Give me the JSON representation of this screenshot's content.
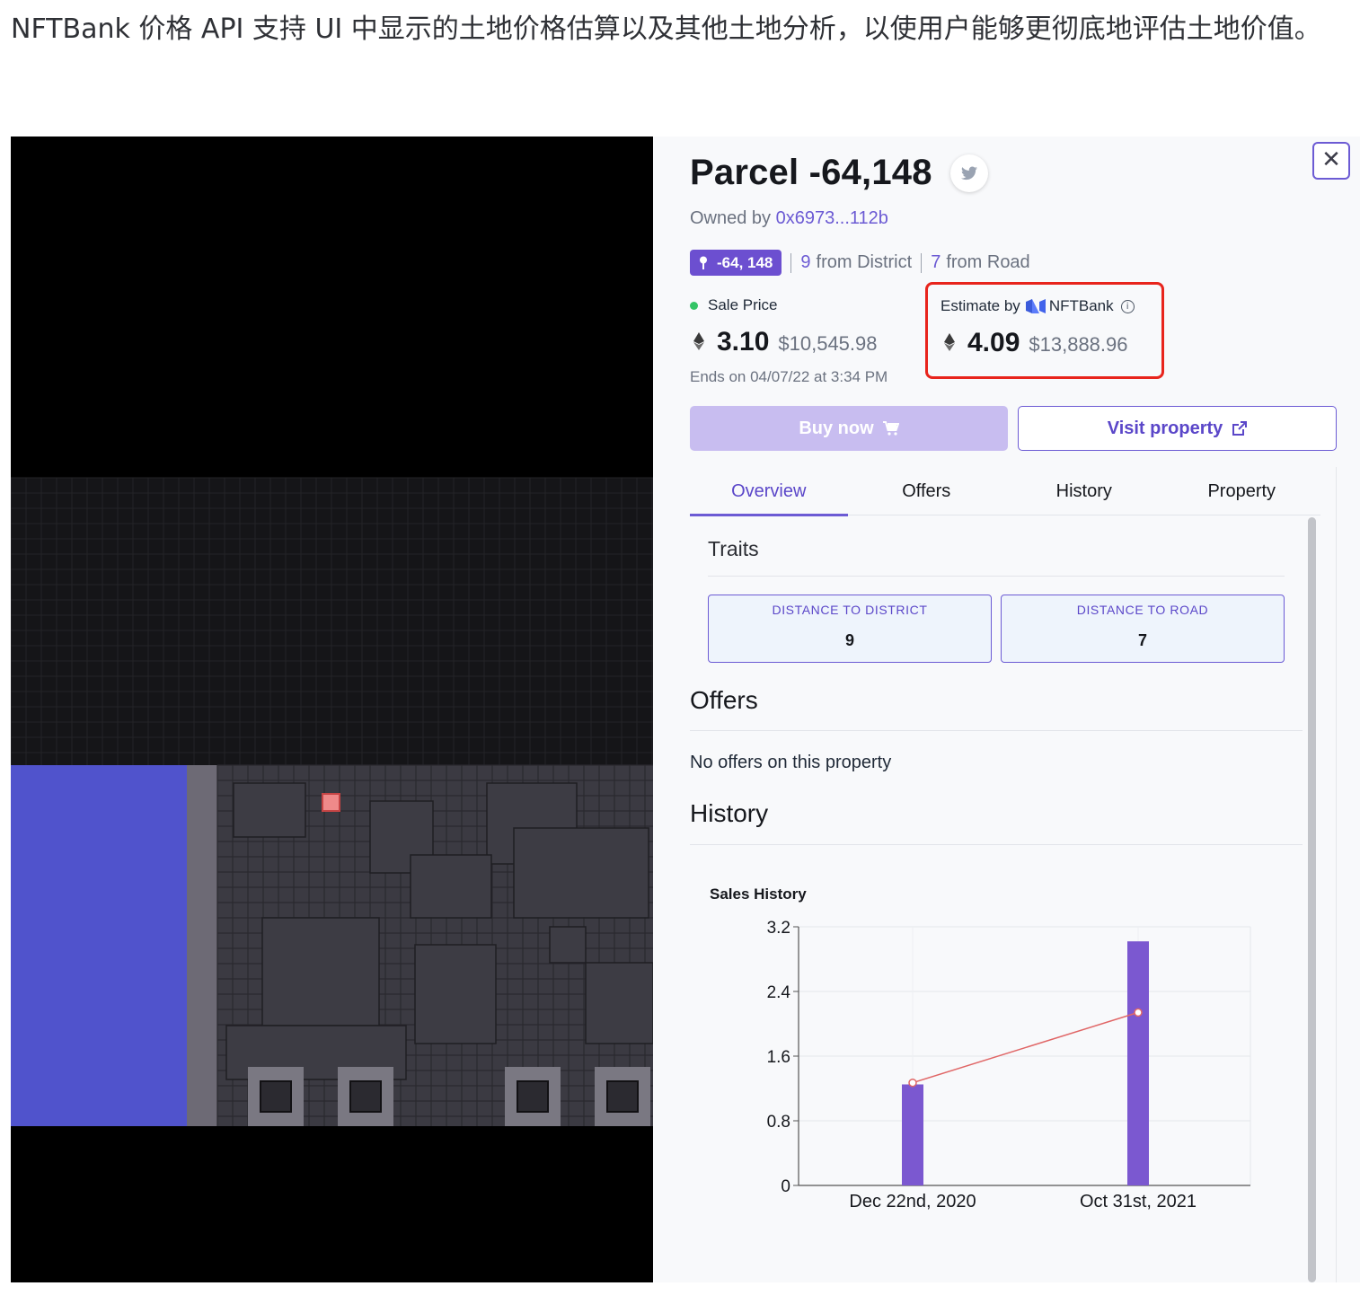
{
  "intro_text": "NFTBank 价格 API 支持 UI 中显示的土地价格估算以及其他土地分析，以使用户能够更彻底地评估土地价值。",
  "colors": {
    "accent": "#6c5bd4",
    "highlight": "#e8241c",
    "district": "#5053cc",
    "selected_parcel": "#ef8a8a"
  },
  "panel": {
    "close_icon": "close-icon",
    "title": "Parcel -64,148",
    "share_icon": "twitter-icon",
    "owner_prefix": "Owned by",
    "owner_address": "0x6973...112b",
    "coords_badge": "-64, 148",
    "district_distance": "9",
    "district_label": "from District",
    "road_distance": "7",
    "road_label": "from Road",
    "sale": {
      "label": "Sale Price",
      "eth": "3.10",
      "usd": "$10,545.98",
      "ends": "Ends on 04/07/22 at 3:34 PM"
    },
    "estimate": {
      "label": "Estimate by",
      "provider": "NFTBank",
      "eth": "4.09",
      "usd": "$13,888.96"
    },
    "buy_label": "Buy now",
    "visit_label": "Visit property",
    "tabs": [
      {
        "label": "Overview",
        "active": true
      },
      {
        "label": "Offers",
        "active": false
      },
      {
        "label": "History",
        "active": false
      },
      {
        "label": "Property",
        "active": false
      }
    ],
    "traits_title": "Traits",
    "traits": [
      {
        "label": "DISTANCE TO DISTRICT",
        "value": "9"
      },
      {
        "label": "DISTANCE TO ROAD",
        "value": "7"
      }
    ],
    "offers_title": "Offers",
    "no_offers": "No offers on this property",
    "history_title": "History"
  },
  "chart_data": {
    "type": "bar",
    "title": "Sales History",
    "categories": [
      "Dec 22nd, 2020",
      "Oct 31st, 2021"
    ],
    "series": [
      {
        "type": "bar",
        "values": [
          1.25,
          3.02
        ],
        "color": "#7b58d0"
      },
      {
        "type": "line",
        "values": [
          1.27,
          2.14
        ],
        "color": "#e06666"
      }
    ],
    "yticks": [
      "0",
      "0.8",
      "1.6",
      "2.4",
      "3.2"
    ],
    "ylim": [
      0,
      3.2
    ],
    "grid": true
  }
}
